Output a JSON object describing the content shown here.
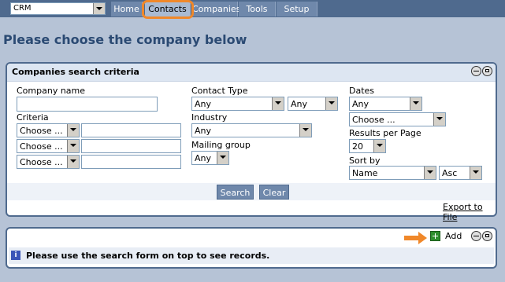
{
  "nav": {
    "module_select": "CRM",
    "tabs": [
      "Home",
      "Contacts",
      "Companies",
      "Tools",
      "Setup"
    ],
    "active_tab": "Contacts",
    "highlight_color": "#f0882a"
  },
  "page_title": "Please choose the company below",
  "search_panel": {
    "title": "Companies search criteria",
    "company_name_label": "Company name",
    "company_name_value": "",
    "criteria_label": "Criteria",
    "criteria_rows": [
      {
        "select": "Choose ...",
        "value": ""
      },
      {
        "select": "Choose ...",
        "value": ""
      },
      {
        "select": "Choose ...",
        "value": ""
      }
    ],
    "contact_type_label": "Contact Type",
    "contact_type_value": "Any",
    "contact_type_value2": "Any",
    "industry_label": "Industry",
    "industry_value": "Any",
    "mailing_group_label": "Mailing group",
    "mailing_group_value": "Any",
    "dates_label": "Dates",
    "dates_value": "Any",
    "dates_range_value": "Choose ...",
    "results_label": "Results per Page",
    "results_value": "20",
    "sort_label": "Sort by",
    "sort_field_value": "Name",
    "sort_order_value": "Asc",
    "search_button": "Search",
    "clear_button": "Clear",
    "export_link": "Export to File"
  },
  "results_panel": {
    "add_label": "Add",
    "info_message": "Please use the search form on top to see records."
  },
  "icons": {
    "minimize": "minimize-icon",
    "restore": "restore-icon",
    "add": "plus-icon",
    "pointer": "arrow-pointer-icon",
    "info": "info-icon"
  }
}
